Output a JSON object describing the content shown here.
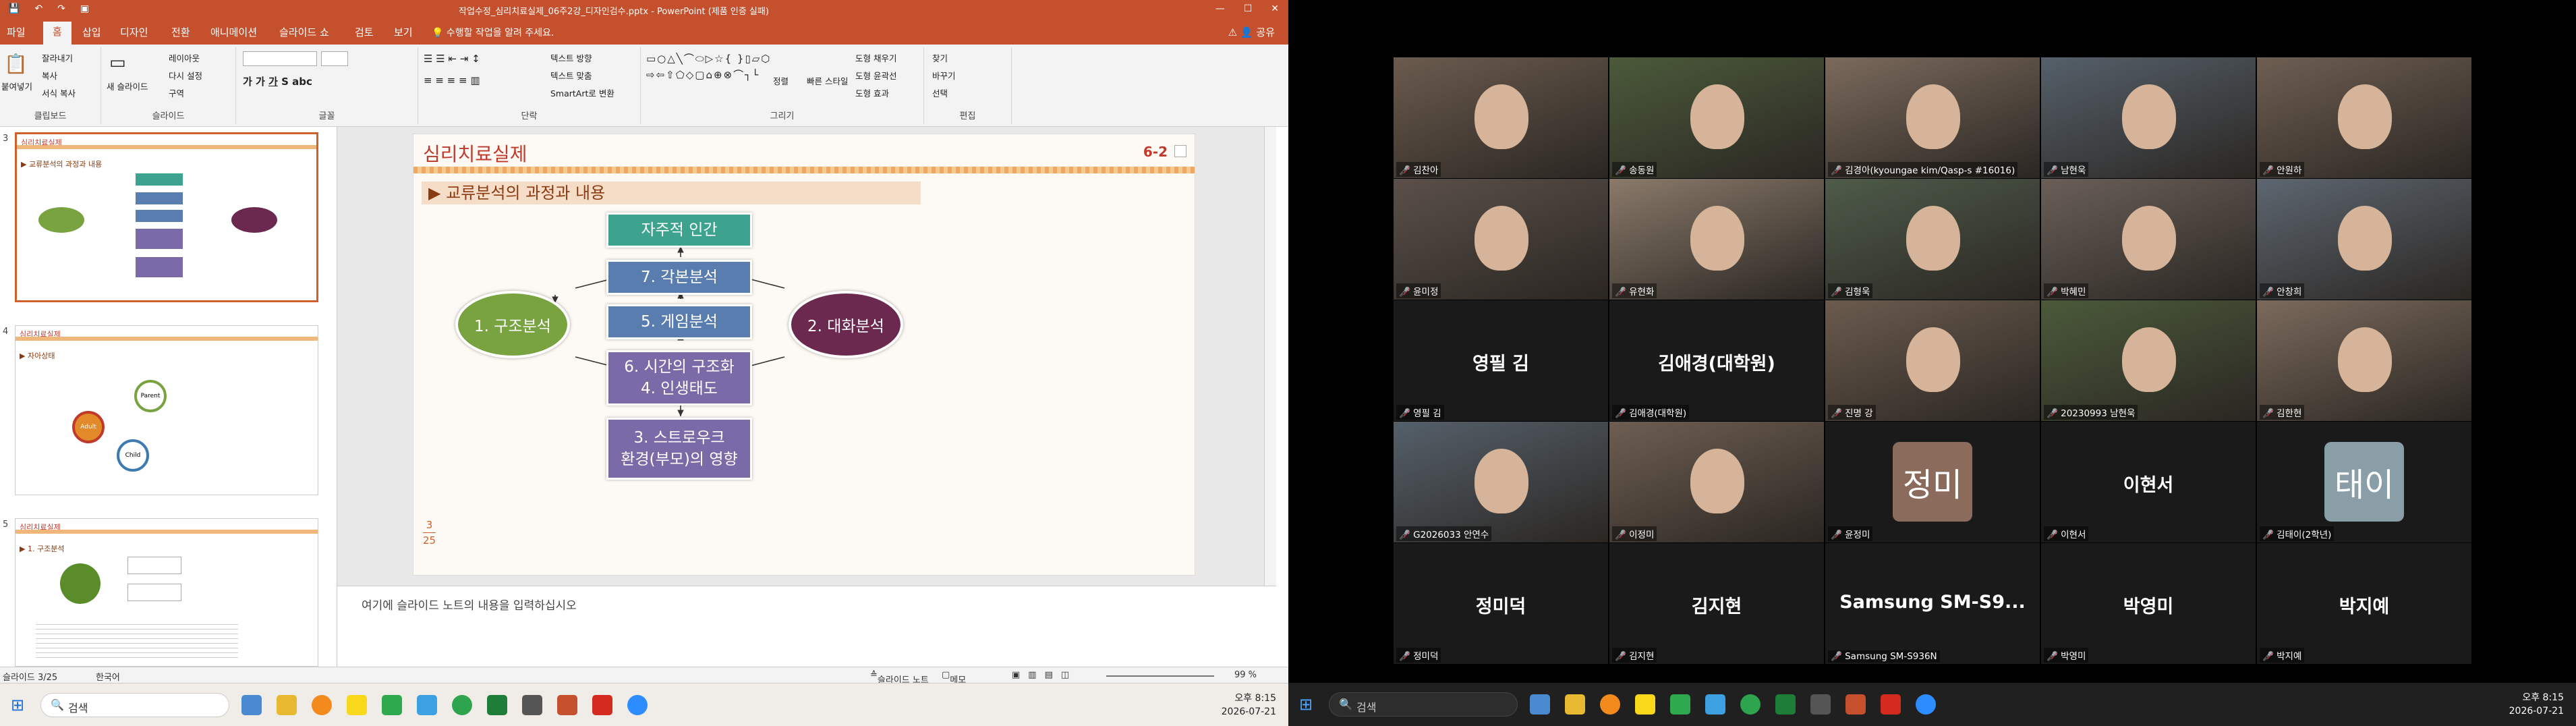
{
  "ppt": {
    "window_title": "작업수정_심리치료실제_06주2강_디자인검수.pptx - PowerPoint (제품 인증 실패)",
    "tabs": [
      "파일",
      "홈",
      "삽입",
      "디자인",
      "전환",
      "애니메이션",
      "슬라이드 쇼",
      "검토",
      "보기"
    ],
    "search_hint": "수행할 작업을 알려 주세요.",
    "share": "공유",
    "ribbon_groups": [
      "클립보드",
      "슬라이드",
      "글꼴",
      "단락",
      "그리기",
      "편집"
    ],
    "ribbon_buttons": {
      "paste": "붙여넣기",
      "cut": "잘라내기",
      "copy": "복사",
      "format_painter": "서식 복사",
      "new_slide": "새 슬라이드",
      "layout": "레이아웃",
      "reset": "다시 설정",
      "section": "구역",
      "text_direction": "텍스트 방향",
      "align_text": "텍스트 맞춤",
      "smartart": "SmartArt로 변환",
      "arrange": "정렬",
      "quick_styles": "빠른 스타일",
      "shape_fill": "도형 채우기",
      "shape_outline": "도형 윤곽선",
      "shape_effects": "도형 효과",
      "find": "찾기",
      "replace": "바꾸기",
      "select": "선택"
    },
    "thumbnails": [
      {
        "num": "3",
        "title": "심리치료실제",
        "sub": "▶ 교류분석의 과정과 내용"
      },
      {
        "num": "4",
        "title": "심리치료실제",
        "sub": "▶ 자아상태"
      },
      {
        "num": "5",
        "title": "심리치료실제",
        "sub": "▶ 1. 구조분석"
      }
    ],
    "thumb4_labels": [
      "Parent\n(부모자아)",
      "Adult\n(성인자아)",
      "Child\n(아동자아)"
    ],
    "slide": {
      "title": "심리치료실제",
      "number": "6-2",
      "subtitle": "교류분석의 과정과 내용",
      "page_current": "3",
      "page_total": "25",
      "boxes": {
        "autonomous": "자주적 인간",
        "script": "7. 각본분석",
        "game": "5. 게임분석",
        "time": "6. 시간의 구조화\n4. 인생태도",
        "stroke": "3. 스트로우크\n환경(부모)의 영향",
        "structural": "1. 구조분석",
        "dialogue": "2. 대화분석"
      }
    },
    "notes_placeholder": "여기에 슬라이드 노트의 내용을 입력하십시오",
    "status": {
      "slide_count": "슬라이드 3/25",
      "language": "한국어",
      "notes": "슬라이드 노트",
      "comments": "메모",
      "zoom": "99 %"
    }
  },
  "taskbar_left": {
    "search": "검색",
    "time": "오후 8:15",
    "date": "2026-07-21"
  },
  "taskbar_right": {
    "search": "검색",
    "time": "오후 8:15",
    "date": "2026-07-21"
  },
  "zoom": {
    "participants": [
      {
        "name": "김찬아",
        "type": "video"
      },
      {
        "name": "송동원",
        "type": "video",
        "speaking": true
      },
      {
        "name": "김경아(kyoungae kim/Qasp-s #16016)",
        "type": "video"
      },
      {
        "name": "남현욱",
        "type": "video"
      },
      {
        "name": "안원하",
        "type": "video"
      },
      {
        "name": "윤미정",
        "type": "video"
      },
      {
        "name": "유현화",
        "type": "video"
      },
      {
        "name": "김형욱",
        "type": "video"
      },
      {
        "name": "박혜민",
        "type": "video"
      },
      {
        "name": "안창희",
        "type": "video"
      },
      {
        "name": "영필 김",
        "type": "name",
        "display": "영필 김"
      },
      {
        "name": "김애경(대학원)",
        "type": "name",
        "display": "김애경(대학원)"
      },
      {
        "name": "진명 강",
        "type": "video"
      },
      {
        "name": "20230993 남현욱",
        "type": "video"
      },
      {
        "name": "김한현",
        "type": "video"
      },
      {
        "name": "G2026033 안연수",
        "type": "video"
      },
      {
        "name": "이정미",
        "type": "video"
      },
      {
        "name": "윤정미",
        "type": "avatar",
        "avatar": "정미",
        "color": "#8b6c5c"
      },
      {
        "name": "이현서",
        "type": "name",
        "display": "이현서"
      },
      {
        "name": "김태이(2학년)",
        "type": "avatar",
        "avatar": "태이",
        "color": "#8a9ea8"
      },
      {
        "name": "정미덕",
        "type": "name",
        "display": "정미덕"
      },
      {
        "name": "김지현",
        "type": "name",
        "display": "김지현"
      },
      {
        "name": "Samsung SM-S936N",
        "type": "name",
        "display": "Samsung  SM-S9..."
      },
      {
        "name": "박영미",
        "type": "name",
        "display": "박영미"
      },
      {
        "name": "박지예",
        "type": "name",
        "display": "박지예"
      }
    ]
  }
}
